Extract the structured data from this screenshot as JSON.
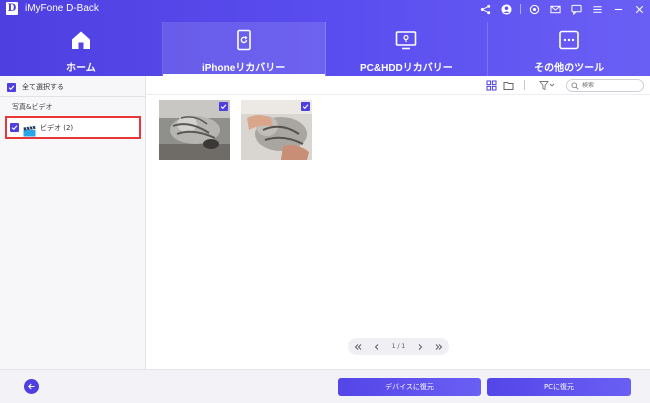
{
  "app": {
    "logo_letter": "D",
    "title": "iMyFone D-Back"
  },
  "titlebar_icons": [
    "share-icon",
    "user-icon",
    "settings-icon",
    "mail-icon",
    "chat-icon",
    "menu-icon",
    "minimize-icon",
    "close-icon"
  ],
  "tabs": [
    {
      "label": "ホーム",
      "icon": "home-icon",
      "active": false
    },
    {
      "label": "iPhoneリカバリー",
      "icon": "phone-recovery-icon",
      "active": true
    },
    {
      "label": "PC&HDDリカバリー",
      "icon": "pc-recovery-icon",
      "active": false
    },
    {
      "label": "その他のツール",
      "icon": "more-tools-icon",
      "active": false
    }
  ],
  "sidebar": {
    "select_all_label": "全て選択する",
    "section_title": "写真&ビデオ",
    "items": [
      {
        "label": "ビデオ (2)",
        "icon": "video-clapper-icon",
        "checked": true
      }
    ]
  },
  "toolbar": {
    "icons": [
      "grid-view-icon",
      "folder-icon",
      "filter-icon"
    ],
    "search_placeholder": "検索"
  },
  "thumbnails": [
    {
      "name": "cat video 1",
      "checked": true
    },
    {
      "name": "cat video 2",
      "checked": true
    }
  ],
  "pagination": {
    "current_display": "1 / 1"
  },
  "bottom": {
    "restore_device_label": "デバイスに復元",
    "restore_pc_label": "PCに復元"
  },
  "colors": {
    "accent": "#4e3fe0",
    "highlight_border": "#e63838"
  }
}
